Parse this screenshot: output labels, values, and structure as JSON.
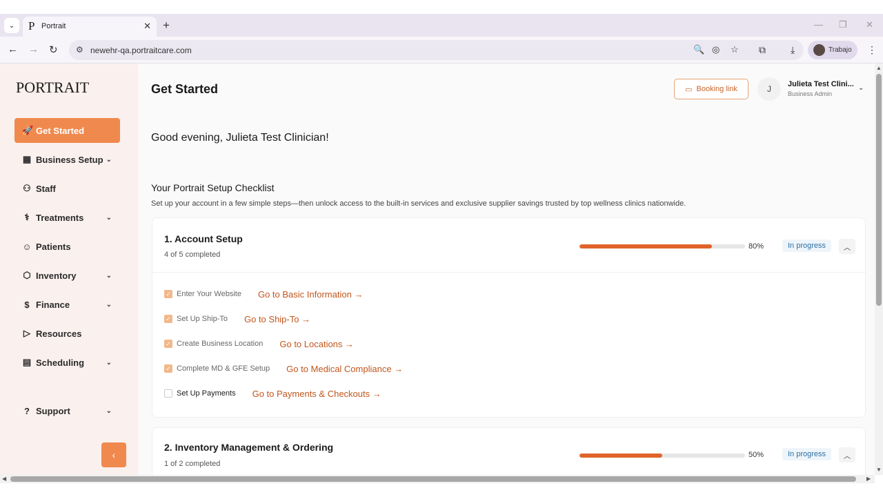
{
  "browser": {
    "tab_title": "Portrait",
    "tab_favicon": "P",
    "url": "newehr-qa.portraitcare.com",
    "profile_label": "Trabajo"
  },
  "app": {
    "logo": "PORTRAIT",
    "sidebar": {
      "items": [
        {
          "label": "Get Started",
          "icon": "rocket-icon",
          "active": true
        },
        {
          "label": "Business Setup",
          "icon": "building-icon",
          "has_chevron": true
        },
        {
          "label": "Staff",
          "icon": "users-icon"
        },
        {
          "label": "Treatments",
          "icon": "treatment-icon",
          "has_chevron": true
        },
        {
          "label": "Patients",
          "icon": "patients-icon"
        },
        {
          "label": "Inventory",
          "icon": "box-icon",
          "has_chevron": true
        },
        {
          "label": "Finance",
          "icon": "dollar-icon",
          "has_chevron": true
        },
        {
          "label": "Resources",
          "icon": "play-icon"
        },
        {
          "label": "Scheduling",
          "icon": "calendar-icon",
          "has_chevron": true
        },
        {
          "label": "Support",
          "icon": "help-icon",
          "has_chevron": true
        }
      ]
    },
    "header": {
      "title": "Get Started",
      "booking_label": "Booking link",
      "user_initial": "J",
      "user_name": "Julieta Test Clini...",
      "user_role": "Business Admin"
    },
    "greeting": "Good evening, Julieta Test Clinician!",
    "checklist": {
      "title": "Your Portrait Setup Checklist",
      "subtitle": "Set up your account in a few simple steps—then unlock access to the built-in services and exclusive supplier savings trusted by top wellness clinics nationwide.",
      "sections": [
        {
          "title": "1. Account Setup",
          "completed_text": "4 of 5 completed",
          "progress": 0.8,
          "percent_label": "80%",
          "status": "In progress",
          "tasks": [
            {
              "label": "Enter Your Website",
              "done": true,
              "link": "Go to Basic Information →"
            },
            {
              "label": "Set Up Ship-To",
              "done": true,
              "link": "Go to Ship-To →"
            },
            {
              "label": "Create Business Location",
              "done": true,
              "link": "Go to Locations →"
            },
            {
              "label": "Complete MD & GFE Setup",
              "done": true,
              "link": "Go to Medical Compliance →"
            },
            {
              "label": "Set Up Payments",
              "done": false,
              "link": "Go to Payments & Checkouts →"
            }
          ]
        },
        {
          "title": "2. Inventory Management & Ordering",
          "completed_text": "1 of 2 completed",
          "progress": 0.5,
          "percent_label": "50%",
          "status": "In progress"
        }
      ]
    }
  },
  "colors": {
    "accent": "#f0894e",
    "link": "#c2561c",
    "progress": "#e0642a",
    "sidebar_bg": "#faf0ee"
  }
}
